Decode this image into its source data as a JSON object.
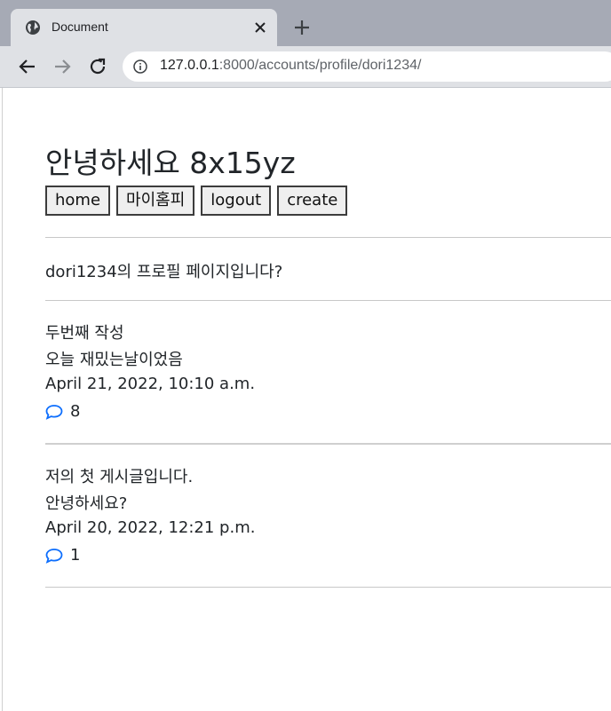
{
  "browser": {
    "tab_title": "Document",
    "url_host": "127.0.0.1",
    "url_path": ":8000/accounts/profile/dori1234/"
  },
  "page": {
    "greeting": "안녕하세요 8x15yz",
    "buttons": {
      "home": "home",
      "my_homepage": "마이홈피",
      "logout": "logout",
      "create": "create"
    },
    "profile_text": "dori1234의 프로필 페이지입니다?",
    "posts": [
      {
        "title": "두번째 작성",
        "content": "오늘 재밌는날이었음",
        "date": "April 21, 2022, 10:10 a.m.",
        "comment_count": "8"
      },
      {
        "title": "저의 첫 게시글입니다.",
        "content": "안녕하세요?",
        "date": "April 20, 2022, 12:21 p.m.",
        "comment_count": "1"
      }
    ]
  },
  "colors": {
    "comment_icon": "#0d6efd",
    "text": "#212529"
  }
}
